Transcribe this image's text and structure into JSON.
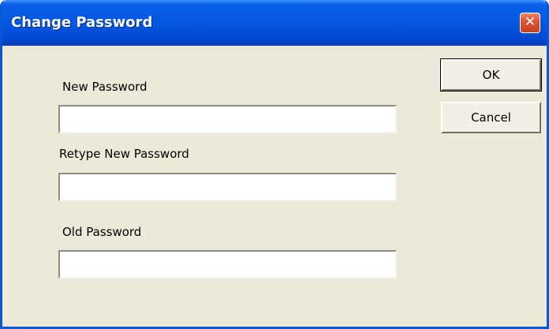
{
  "window": {
    "title": "Change Password",
    "close_glyph": "✕"
  },
  "fields": {
    "new_password": {
      "label": "New Password",
      "value": ""
    },
    "retype_password": {
      "label": "Retype New Password",
      "value": ""
    },
    "old_password": {
      "label": "Old Password",
      "value": ""
    }
  },
  "buttons": {
    "ok_label": "OK",
    "cancel_label": "Cancel"
  },
  "colors": {
    "titlebar": "#0558e0",
    "dialog_background": "#ece9d8",
    "close_button": "#d8552e"
  }
}
